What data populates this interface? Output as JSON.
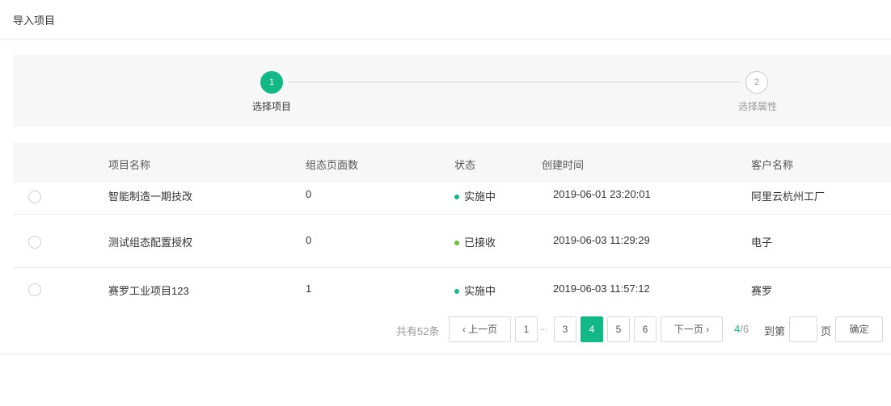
{
  "header": {
    "title": "导入项目"
  },
  "steps": [
    {
      "number": "1",
      "label": "选择项目",
      "active": true
    },
    {
      "number": "2",
      "label": "选择属性",
      "active": false
    }
  ],
  "table": {
    "columns": [
      "项目名称",
      "组态页面数",
      "状态",
      "创建时间",
      "客户名称"
    ],
    "rows": [
      {
        "name": "智能制造一期技改",
        "pages": "0",
        "status": "实施中",
        "status_color": "#12b886",
        "created": "2019-06-01 23:20:01",
        "customer": "阿里云杭州工厂"
      },
      {
        "name": "测试组态配置授权",
        "pages": "0",
        "status": "已接收",
        "status_color": "#67c23a",
        "created": "2019-06-03 11:29:29",
        "customer": "电子"
      },
      {
        "name": "赛罗工业项目123",
        "pages": "1",
        "status": "实施中",
        "status_color": "#12b886",
        "created": "2019-06-03 11:57:12",
        "customer": "赛罗"
      }
    ]
  },
  "pagination": {
    "total_text": "共有52条",
    "prev": "上一页",
    "next": "下一页",
    "pages": [
      "1",
      "3",
      "4",
      "5",
      "6"
    ],
    "ellipsis": "...",
    "current": "4",
    "total_pages": "/6",
    "goto_label": "到第",
    "page_unit": "页",
    "confirm": "确定",
    "goto_value": ""
  },
  "colors": {
    "accent": "#12b886",
    "received": "#67c23a"
  }
}
